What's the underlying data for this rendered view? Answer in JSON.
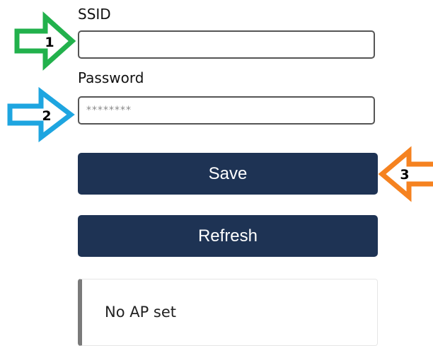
{
  "form": {
    "ssid_label": "SSID",
    "ssid_value": "",
    "password_label": "Password",
    "password_placeholder": "********",
    "save_label": "Save",
    "refresh_label": "Refresh",
    "status_text": "No AP set"
  },
  "callouts": [
    {
      "number": "1",
      "color": "#22b14c",
      "icon": "arrow-right-icon"
    },
    {
      "number": "2",
      "color": "#1ea5e0",
      "icon": "arrow-right-icon"
    },
    {
      "number": "3",
      "color": "#f58220",
      "icon": "arrow-left-icon"
    }
  ],
  "colors": {
    "button_bg": "#1e3354",
    "button_text": "#ffffff",
    "status_accent": "#7a7a7a"
  }
}
